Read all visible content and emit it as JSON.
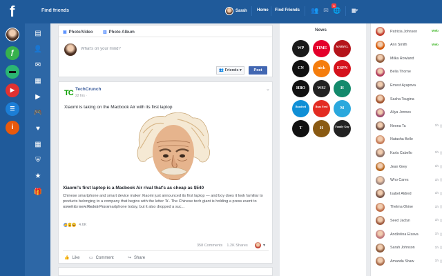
{
  "topbar": {
    "logo": "f",
    "search_placeholder": "Find friends",
    "user_name": "Sarah",
    "home": "Home",
    "find_friends": "Find Friends",
    "notification_count": "8"
  },
  "composer": {
    "tab_photo_video": "Photo/Video",
    "tab_photo_album": "Photo Album",
    "placeholder": "What's on your mind?",
    "audience": "Friends",
    "post": "Post"
  },
  "post": {
    "author": "TechCrunch",
    "logo_text": "TC",
    "time": "22 hrs ·",
    "text": "Xiaomi is taking on the Macbook Air with its first laptop",
    "link_title": "Xiaomi's first laptop is a Macbook Air rival that's as cheap as $540",
    "link_desc": "Chinese smartphone and smart device maker Xiaomi just announced its first laptop — and boy does it look familiar to products belonging to a company that begins with the letter 'A'. The Chinese tech giant is holding a press event to unveil its new Redmi Pro smartphone today, but it also dropped a suc...",
    "link_domain": "SOCIAL.TECHCRUNCH.COM",
    "reaction_count": "4.6K",
    "comments": "358 Comments",
    "shares": "1.2K Shares",
    "like": "Like",
    "comment": "Comment",
    "share": "Share"
  },
  "news": {
    "title": "News",
    "sources": [
      {
        "label": "WP",
        "color": "#1a1a1a"
      },
      {
        "label": "TIME",
        "color": "#e4002b"
      },
      {
        "label": "MARVEL",
        "color": "#b5141b"
      },
      {
        "label": "CN",
        "color": "#111111"
      },
      {
        "label": "nick",
        "color": "#f57d0d"
      },
      {
        "label": "ESPN",
        "color": "#d5121c"
      },
      {
        "label": "HBO",
        "color": "#111111"
      },
      {
        "label": "WSJ",
        "color": "#222222"
      },
      {
        "label": "H",
        "color": "#138a6c"
      },
      {
        "label": "Buzzfeed",
        "color": "#0f8fd6"
      },
      {
        "label": "Buzz Feed",
        "color": "#e32c22"
      },
      {
        "label": "M",
        "color": "#2aa8dd"
      },
      {
        "label": "T",
        "color": "#111111"
      },
      {
        "label": "H",
        "color": "#8a5a12"
      },
      {
        "label": "Family Guy",
        "color": "#222222"
      }
    ]
  },
  "chat": [
    {
      "name": "Patricia Johnson",
      "status": "Web",
      "online": true
    },
    {
      "name": "Ann Smith",
      "status": "Web",
      "online": true
    },
    {
      "name": "Milka Rowland",
      "status": "",
      "online": false
    },
    {
      "name": "Bella Thorne",
      "status": "",
      "online": false
    },
    {
      "name": "Ernest Ayapova",
      "status": "",
      "online": false
    },
    {
      "name": "Sasha Tsugina",
      "status": "",
      "online": false
    },
    {
      "name": "Aliya Jonnes",
      "status": "",
      "online": false
    },
    {
      "name": "Neona Ta",
      "status": "1h",
      "online": false
    },
    {
      "name": "Natasha Belle",
      "status": "",
      "online": false
    },
    {
      "name": "Karla Cabello",
      "status": "1h",
      "online": false
    },
    {
      "name": "Jean Grey",
      "status": "1h",
      "online": false
    },
    {
      "name": "Who Cares",
      "status": "1h",
      "online": false
    },
    {
      "name": "Isabel Aldred",
      "status": "1h",
      "online": false
    },
    {
      "name": "Thelma Okine",
      "status": "1h",
      "online": false
    },
    {
      "name": "Seed Jaclyn",
      "status": "1h",
      "online": false
    },
    {
      "name": "Andželina Elzava",
      "status": "1h",
      "online": false
    },
    {
      "name": "Sarah Johnson",
      "status": "1h",
      "online": false
    },
    {
      "name": "Amanda Shaw",
      "status": "1h",
      "online": false
    }
  ]
}
